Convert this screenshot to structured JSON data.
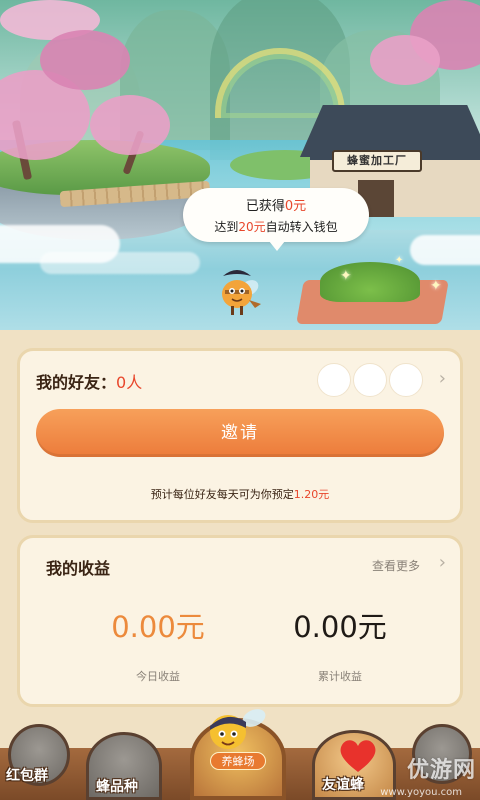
{
  "scene": {
    "factory_sign": "蜂蜜加工厂",
    "bubble": {
      "line1_prefix": "已获得",
      "line1_amount": "0元",
      "line2_prefix": "达到",
      "line2_amount": "20元",
      "line2_suffix": "自动转入钱包"
    }
  },
  "friends": {
    "title": "我的好友：",
    "count": "0人",
    "invite_label": "邀请",
    "note_prefix": "预计每位好友每天可为你预定",
    "note_amount": "1.20元"
  },
  "earnings": {
    "title": "我的收益",
    "see_more": "查看更多",
    "today_value": "0.00元",
    "today_label": "今日收益",
    "total_value": "0.00元",
    "total_label": "累计收益"
  },
  "nav": {
    "items": [
      {
        "label": "红包群",
        "icon": "red-packet-icon"
      },
      {
        "label": "蜂品种",
        "icon": "bee-variety-icon"
      },
      {
        "label": "养蜂场",
        "icon": "bee-farm-icon"
      },
      {
        "label": "友谊蜂",
        "icon": "heart-icon"
      },
      {
        "label": "",
        "icon": "more-icon"
      }
    ]
  },
  "watermark": {
    "main": "优游网",
    "sub": "www.yoyou.com"
  },
  "colors": {
    "accent": "#ec7b3a",
    "highlight": "#e8472c",
    "card_bg": "#fbf3e3"
  }
}
